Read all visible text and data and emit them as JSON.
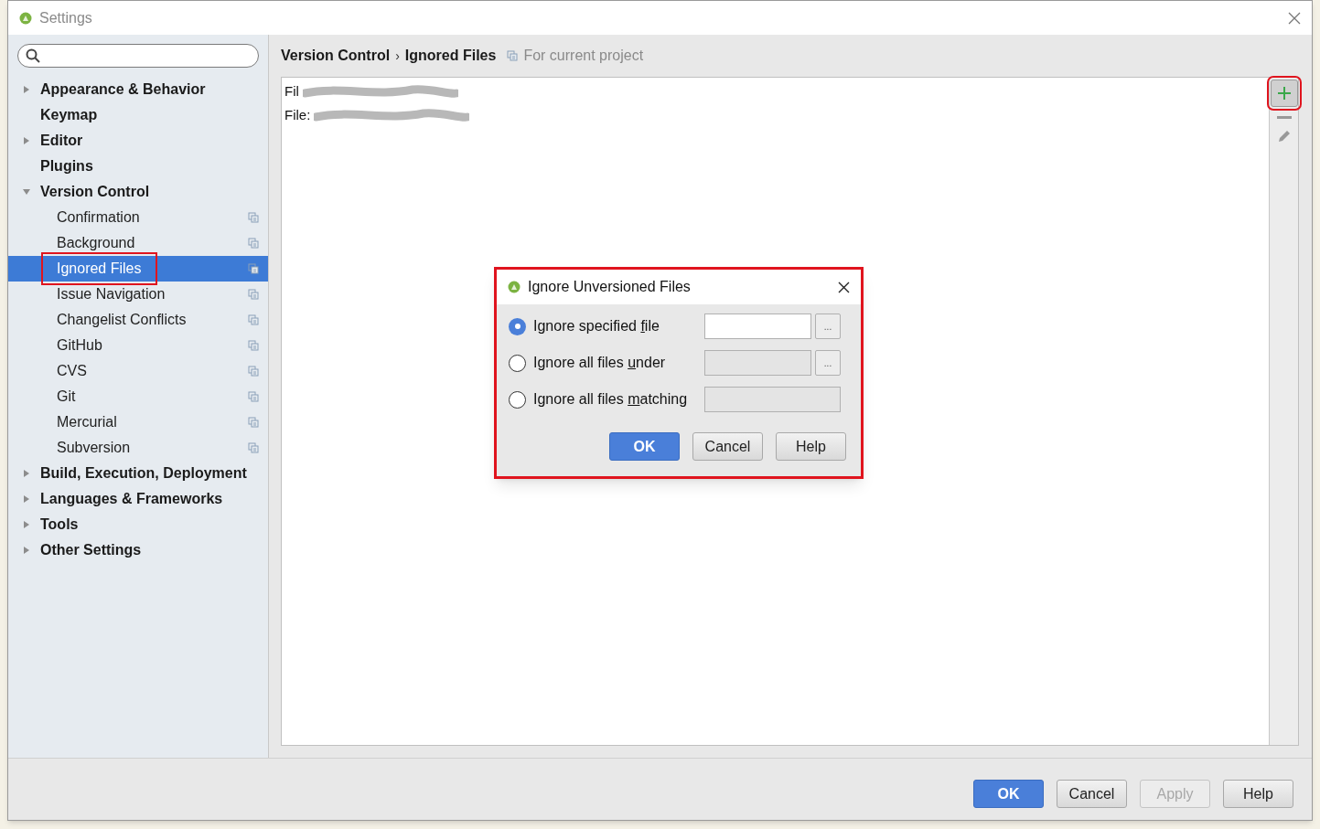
{
  "window": {
    "title": "Settings"
  },
  "sidebar": {
    "items": [
      {
        "label": "Appearance & Behavior",
        "expanded": false
      },
      {
        "label": "Keymap"
      },
      {
        "label": "Editor",
        "expanded": false
      },
      {
        "label": "Plugins"
      },
      {
        "label": "Version Control",
        "expanded": true,
        "children": [
          {
            "label": "Confirmation",
            "selected": false,
            "highlighted": false
          },
          {
            "label": "Background",
            "selected": false,
            "highlighted": false
          },
          {
            "label": "Ignored Files",
            "selected": true,
            "highlighted": true
          },
          {
            "label": "Issue Navigation",
            "selected": false,
            "highlighted": false
          },
          {
            "label": "Changelist Conflicts",
            "selected": false,
            "highlighted": false
          },
          {
            "label": "GitHub",
            "selected": false,
            "highlighted": false
          },
          {
            "label": "CVS",
            "selected": false,
            "highlighted": false
          },
          {
            "label": "Git",
            "selected": false,
            "highlighted": false
          },
          {
            "label": "Mercurial",
            "selected": false,
            "highlighted": false
          },
          {
            "label": "Subversion",
            "selected": false,
            "highlighted": false
          }
        ]
      },
      {
        "label": "Build, Execution, Deployment",
        "expanded": false
      },
      {
        "label": "Languages & Frameworks",
        "expanded": false
      },
      {
        "label": "Tools",
        "expanded": false
      },
      {
        "label": "Other Settings",
        "expanded": false
      }
    ]
  },
  "breadcrumb": {
    "parts": [
      "Version Control",
      "Ignored Files"
    ],
    "separator": "›",
    "scope": "For current project"
  },
  "ignored_list": {
    "rows": [
      {
        "text": "Fil"
      },
      {
        "text": "File:"
      }
    ]
  },
  "toolbar": {
    "add_highlighted": true
  },
  "dialog": {
    "title": "Ignore Unversioned Files",
    "options": [
      {
        "before": "Ignore specified ",
        "key": "f",
        "after": "ile",
        "selected": true,
        "browse": "...",
        "field_enabled": true
      },
      {
        "before": "Ignore all files ",
        "key": "u",
        "after": "nder",
        "selected": false,
        "browse": "...",
        "field_enabled": false
      },
      {
        "before": "Ignore all files ",
        "key": "m",
        "after": "atching",
        "selected": false,
        "field_enabled": false
      }
    ],
    "buttons": [
      {
        "label": "OK",
        "kind": "primary"
      },
      {
        "label": "Cancel",
        "kind": "normal"
      },
      {
        "label": "Help",
        "kind": "normal"
      }
    ],
    "highlighted": true
  },
  "footer": {
    "buttons": [
      {
        "label": "OK",
        "kind": "primary"
      },
      {
        "label": "Cancel",
        "kind": "normal"
      },
      {
        "label": "Apply",
        "kind": "normal",
        "disabled": true
      },
      {
        "label": "Help",
        "kind": "normal"
      }
    ]
  }
}
